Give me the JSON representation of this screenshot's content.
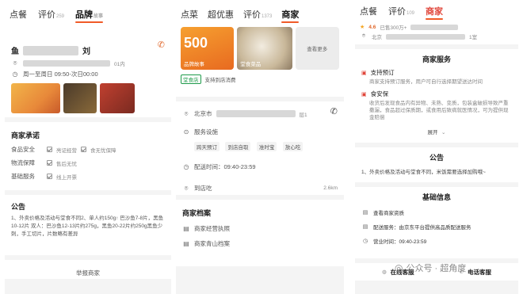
{
  "panel1": {
    "tabs": [
      {
        "label": "点餐",
        "count": ""
      },
      {
        "label": "评价",
        "count": "259"
      },
      {
        "label": "品牌",
        "count": "故事"
      }
    ],
    "store_name_left": "鱼",
    "store_name_right": "刘",
    "address_suffix": "01内",
    "hours": "周一至周日 09:50-次日00:00",
    "commit_title": "商家承诺",
    "commit_rows": [
      {
        "label": "食品安全",
        "items": [
          "亮证经营",
          "食无忧保障"
        ]
      },
      {
        "label": "物流保障",
        "items": [
          "售后无忧"
        ]
      },
      {
        "label": "基础服务",
        "items": [
          "线上开票"
        ]
      }
    ],
    "notice_title": "公告",
    "notice_text": "1、外卖价格及活动与堂食不同2、单人约150g↑ 巴沙鱼7-8片，黑鱼10-12片 双人：巴沙鱼12-13片约275g，黑鱼20-22片约250g黑鱼少刺，手工切片，片数略有差异",
    "report_label": "举报商家"
  },
  "panel2": {
    "tabs": [
      {
        "label": "点菜",
        "count": ""
      },
      {
        "label": "超优惠",
        "count": ""
      },
      {
        "label": "评价",
        "count": "1373"
      },
      {
        "label": "商家",
        "count": ""
      }
    ],
    "tile1_big": "500",
    "tile1_label": "品牌故事",
    "tile2_label": "堂食菜品",
    "see_more": "查看更多",
    "badge_dine": "堂食店",
    "badge_pay": "支持到店消费",
    "address_prefix": "北京市",
    "address_suffix": "层1",
    "facilities_title": "服务设施",
    "facilities": [
      "跨天预订",
      "到店自取",
      "准时宝",
      "放心吃"
    ],
    "delivery_time": "配送时间：09:40-23:59",
    "dine_in": "到店吃",
    "distance": "2.6km",
    "files_title": "商家档案",
    "files": [
      "商家经营执照",
      "商家青山档案"
    ]
  },
  "panel3": {
    "tabs": [
      {
        "label": "点餐",
        "count": ""
      },
      {
        "label": "评价",
        "count": "109"
      },
      {
        "label": "商家",
        "count": ""
      }
    ],
    "rating": "4.6",
    "monthly": "已售300万+",
    "address_prefix": "北京",
    "address_suffix": "1室",
    "service_title": "商家服务",
    "service1_title": "支持预订",
    "service1_text": "商家支持预订服务，用户可自行选择期望送达时间",
    "service2_title": "食安保",
    "service2_text": "收货后发现食品内有异物、未熟、变质，包装盒破损导致严重撒漏，食品超过保质期，或食用后致病就医情况，可为提供现金赔偿",
    "expand": "展开",
    "notice_title": "公告",
    "notice_text": "1、外卖价格及活动与堂食不同，米饭需要选择加购哦~",
    "basic_title": "基础信息",
    "basic_items": [
      "查看商家资质",
      "配送服务：由京东平台提供高品质配送服务",
      "营业时间：09:40-23:59"
    ],
    "online_service": "在线客服",
    "phone_service": "电话客服",
    "watermark": "公众号 · 超角度"
  }
}
